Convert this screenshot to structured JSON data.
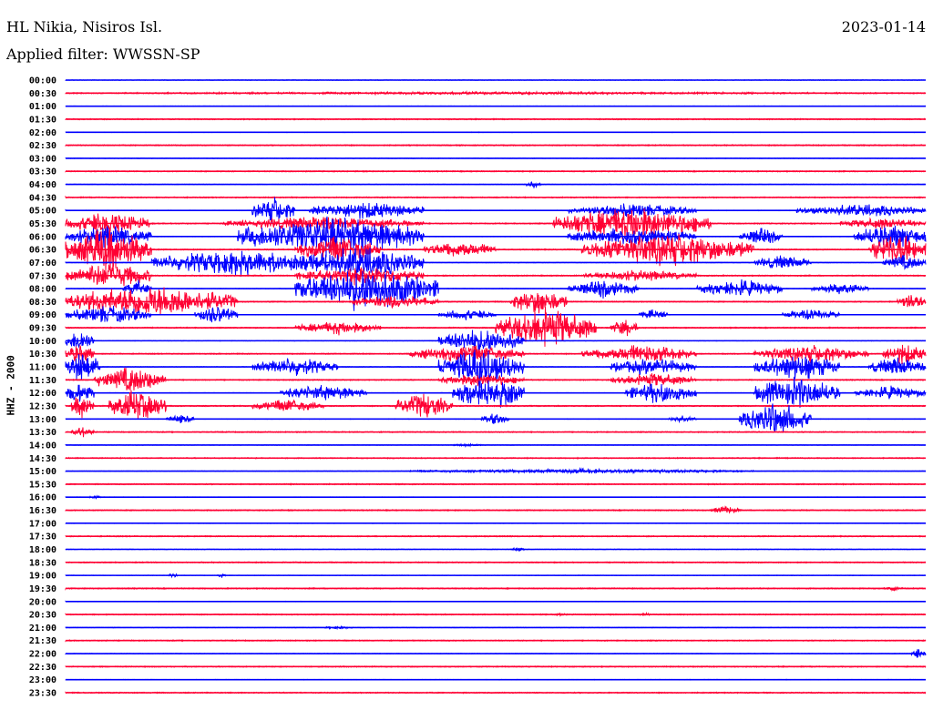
{
  "header": {
    "station": "HL Nikia, Nisiros Isl.",
    "date": "2023-01-14",
    "filter": "Applied filter: WWSSN-SP"
  },
  "chart_data": {
    "type": "line",
    "title": "HL Nikia, Nisiros Isl.",
    "subtitle": "Applied filter: WWSSN-SP",
    "ylabel": "HHZ - 2000",
    "xlabel": "",
    "row_minutes": 30,
    "colors": {
      "even": "#0000ff",
      "odd": "#ff0033"
    },
    "rows": [
      "00:00",
      "00:30",
      "01:00",
      "01:30",
      "02:00",
      "02:30",
      "03:00",
      "03:30",
      "04:00",
      "04:30",
      "05:00",
      "05:30",
      "06:00",
      "06:30",
      "07:00",
      "07:30",
      "08:00",
      "08:30",
      "09:00",
      "09:30",
      "10:00",
      "10:30",
      "11:00",
      "11:30",
      "12:00",
      "12:30",
      "13:00",
      "13:30",
      "14:00",
      "14:30",
      "15:00",
      "15:30",
      "16:00",
      "16:30",
      "17:00",
      "17:30",
      "18:00",
      "18:30",
      "19:00",
      "19:30",
      "20:00",
      "20:30",
      "21:00",
      "21:30",
      "22:00",
      "22:30",
      "23:00",
      "23:30"
    ],
    "bursts_note": "start_min, end_min, relative amplitude (1 = one trace spacing)",
    "bursts": {
      "1": [
        [
          0,
          30,
          0.12
        ]
      ],
      "8": [
        [
          16,
          16.6,
          0.3
        ]
      ],
      "10": [
        [
          6.5,
          8,
          1.2
        ],
        [
          8.5,
          12.5,
          0.8
        ],
        [
          17.5,
          22,
          0.6
        ],
        [
          25.5,
          30,
          0.6
        ]
      ],
      "11": [
        [
          0,
          3,
          1.0
        ],
        [
          5.5,
          12.5,
          0.6
        ],
        [
          17,
          22.5,
          1.5
        ],
        [
          27,
          30,
          0.5
        ]
      ],
      "12": [
        [
          0,
          3,
          1.0
        ],
        [
          6,
          12.5,
          1.8
        ],
        [
          17.5,
          22,
          0.8
        ],
        [
          23.5,
          25,
          0.8
        ],
        [
          27.5,
          30,
          1.2
        ]
      ],
      "13": [
        [
          0,
          3,
          2.0
        ],
        [
          8,
          11,
          1.2
        ],
        [
          12.5,
          15,
          0.8
        ],
        [
          18,
          24,
          1.5
        ],
        [
          28,
          30,
          1.5
        ]
      ],
      "14": [
        [
          3,
          9,
          1.2
        ],
        [
          8,
          12.5,
          1.5
        ],
        [
          24,
          26,
          0.6
        ],
        [
          28.5,
          30,
          0.7
        ]
      ],
      "15": [
        [
          0,
          3,
          1.2
        ],
        [
          8,
          12.5,
          0.8
        ],
        [
          18,
          22,
          0.5
        ]
      ],
      "16": [
        [
          2,
          3,
          0.8
        ],
        [
          8,
          13,
          2.0
        ],
        [
          17.5,
          20,
          0.8
        ],
        [
          22,
          25,
          0.8
        ],
        [
          26,
          28,
          0.5
        ]
      ],
      "17": [
        [
          0,
          6,
          1.5
        ],
        [
          10,
          13,
          0.6
        ],
        [
          15.5,
          17.5,
          1.2
        ],
        [
          29,
          30,
          0.8
        ]
      ],
      "18": [
        [
          0,
          3,
          0.8
        ],
        [
          4.5,
          6,
          0.8
        ],
        [
          13,
          15,
          0.5
        ],
        [
          20,
          21,
          0.5
        ],
        [
          25,
          27,
          0.5
        ]
      ],
      "19": [
        [
          8,
          11,
          0.6
        ],
        [
          15,
          18.5,
          1.8
        ],
        [
          19,
          20,
          0.8
        ]
      ],
      "20": [
        [
          0,
          1,
          1.0
        ],
        [
          13,
          16,
          1.2
        ]
      ],
      "21": [
        [
          0,
          1,
          1.0
        ],
        [
          12,
          16,
          0.8
        ],
        [
          18,
          22,
          0.8
        ],
        [
          24,
          28,
          0.8
        ],
        [
          28.5,
          30,
          1.0
        ]
      ],
      "22": [
        [
          0,
          1.2,
          1.5
        ],
        [
          6.5,
          9.5,
          0.8
        ],
        [
          13,
          16,
          1.8
        ],
        [
          19,
          22,
          0.8
        ],
        [
          24,
          27,
          1.2
        ],
        [
          28,
          30,
          0.8
        ]
      ],
      "23": [
        [
          1,
          3.5,
          1.2
        ],
        [
          13,
          16,
          0.6
        ],
        [
          19,
          22,
          0.6
        ]
      ],
      "24": [
        [
          0,
          1,
          1.0
        ],
        [
          7.5,
          10.5,
          0.7
        ],
        [
          13.5,
          16,
          1.5
        ],
        [
          19.5,
          22,
          1.0
        ],
        [
          24,
          27,
          1.5
        ],
        [
          27.5,
          30,
          0.6
        ]
      ],
      "25": [
        [
          0.2,
          1,
          1.2
        ],
        [
          1.5,
          3.5,
          1.5
        ],
        [
          6.5,
          9,
          0.6
        ],
        [
          11.5,
          13.5,
          1.2
        ]
      ],
      "26": [
        [
          3.5,
          4.5,
          0.4
        ],
        [
          14.5,
          15.5,
          0.5
        ],
        [
          21,
          22,
          0.3
        ],
        [
          23.5,
          26,
          1.5
        ]
      ],
      "27": [
        [
          0.2,
          1,
          0.5
        ]
      ],
      "28": [
        [
          13.5,
          14.5,
          0.15
        ]
      ],
      "30": [
        [
          12,
          24,
          0.2
        ]
      ],
      "32": [
        [
          0.8,
          1.3,
          0.15
        ]
      ],
      "33": [
        [
          22.5,
          23.5,
          0.4
        ]
      ],
      "36": [
        [
          15.5,
          16,
          0.2
        ]
      ],
      "38": [
        [
          3.6,
          3.9,
          0.25
        ],
        [
          5.3,
          5.6,
          0.2
        ]
      ],
      "39": [
        [
          28.5,
          29.2,
          0.2
        ]
      ],
      "41": [
        [
          17,
          17.5,
          0.15
        ],
        [
          20,
          20.5,
          0.15
        ]
      ],
      "42": [
        [
          9,
          10,
          0.15
        ]
      ],
      "44": [
        [
          29.5,
          30,
          0.6
        ]
      ]
    }
  }
}
